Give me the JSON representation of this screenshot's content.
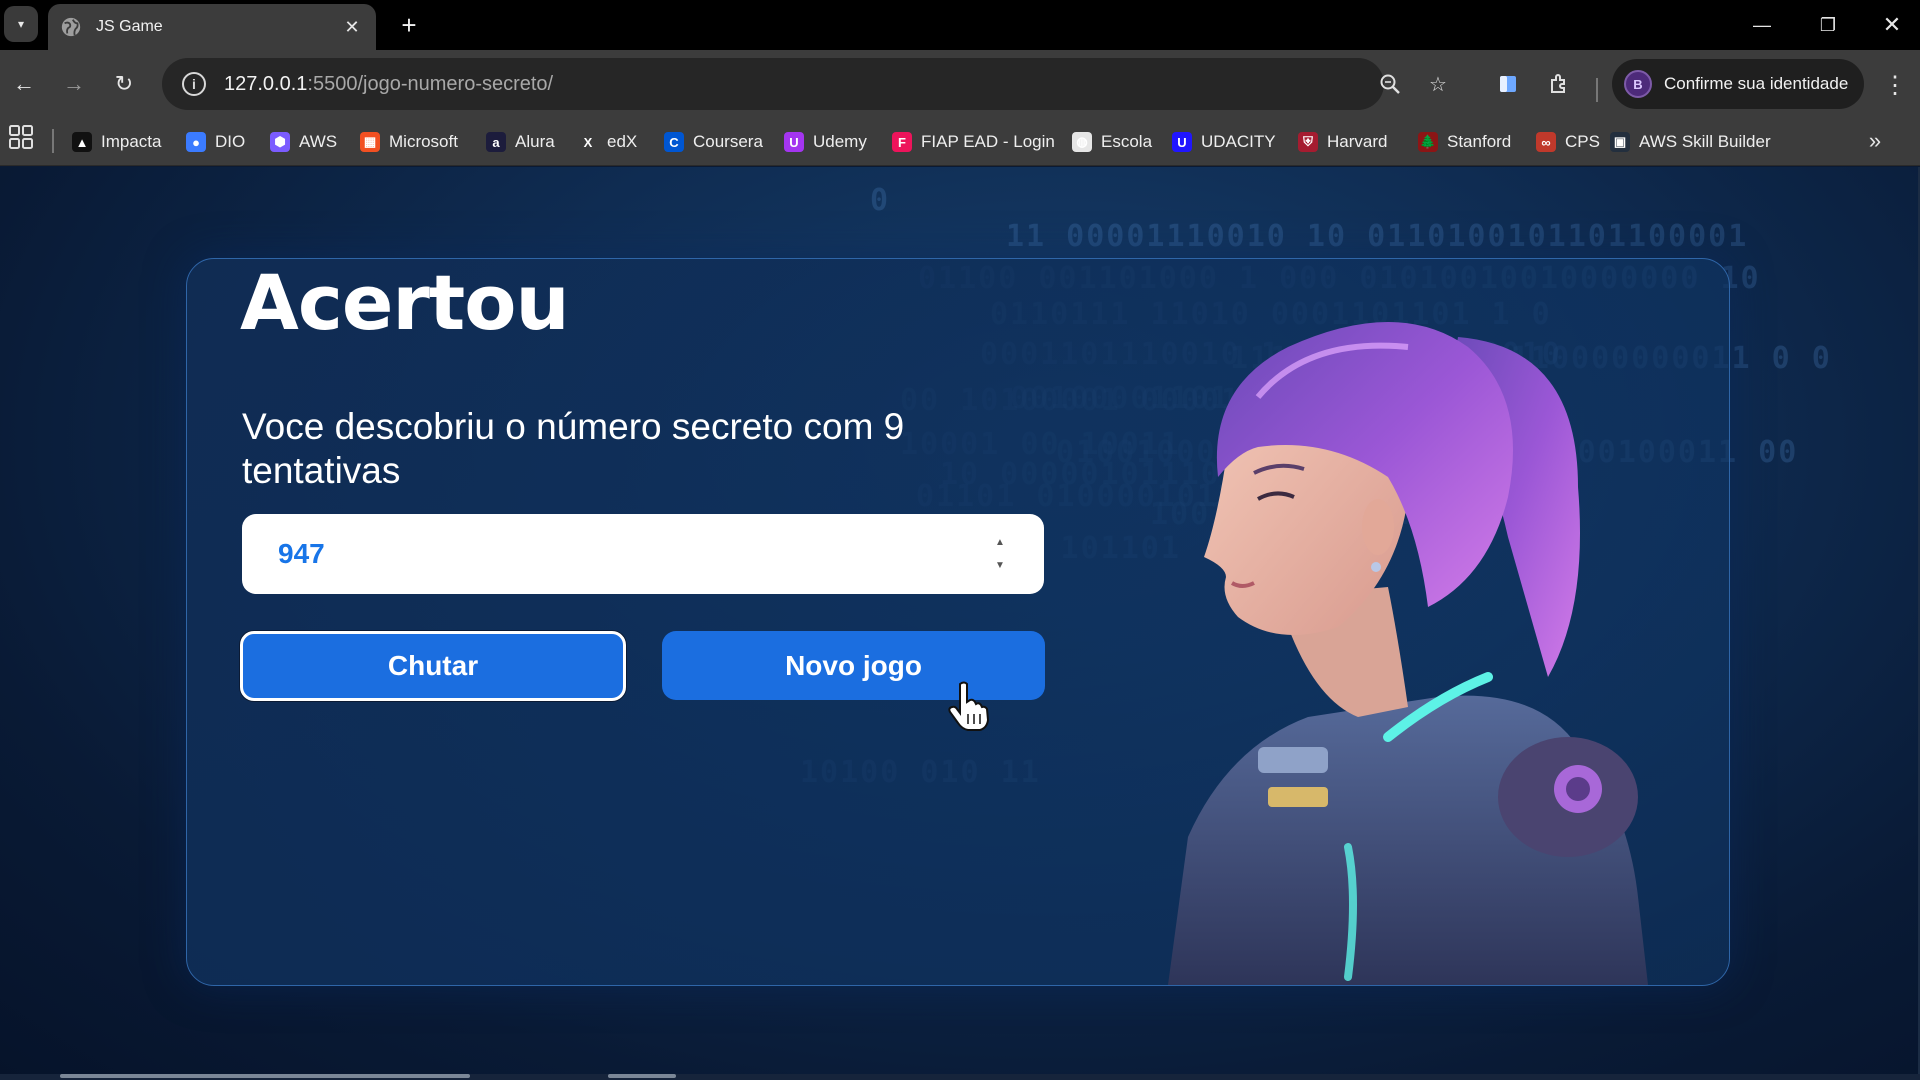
{
  "browser": {
    "tab_title": "JS Game",
    "url_host": "127.0.0.1",
    "url_path": ":5500/jogo-numero-secreto/",
    "profile_initial": "B",
    "profile_label": "Confirme sua identidade"
  },
  "bookmarks": [
    {
      "label": "Impacta",
      "icon": "impacta-icon",
      "color": "#111111"
    },
    {
      "label": "DIO",
      "icon": "dio-icon",
      "color": "#3b7bff"
    },
    {
      "label": "AWS",
      "icon": "aws-cube-icon",
      "color": "#7b5cff"
    },
    {
      "label": "Microsoft",
      "icon": "microsoft-icon",
      "color": "#f25022"
    },
    {
      "label": "Alura",
      "icon": "alura-icon",
      "color": "#1c1c3c"
    },
    {
      "label": "edX",
      "icon": "edx-icon",
      "color": "#3c3c3c"
    },
    {
      "label": "Coursera",
      "icon": "coursera-icon",
      "color": "#0056d2"
    },
    {
      "label": "Udemy",
      "icon": "udemy-icon",
      "color": "#a435f0"
    },
    {
      "label": "FIAP EAD - Login",
      "icon": "fiap-icon",
      "color": "#ed145b"
    },
    {
      "label": "Escola",
      "icon": "globe-icon",
      "color": "#e6e6e6"
    },
    {
      "label": "UDACITY",
      "icon": "udacity-icon",
      "color": "#2015ff"
    },
    {
      "label": "Harvard",
      "icon": "harvard-icon",
      "color": "#a51c30"
    },
    {
      "label": "Stanford",
      "icon": "stanford-icon",
      "color": "#8c1515"
    },
    {
      "label": "CPS",
      "icon": "cps-icon",
      "color": "#c0392b"
    },
    {
      "label": "AWS Skill Builder",
      "icon": "aws-skill-builder-icon",
      "color": "#232f3e"
    }
  ],
  "game": {
    "title": "Acertou",
    "message": "Voce descobriu o número secreto com 9 tentativas",
    "input_value": "947",
    "guess_button": "Chutar",
    "new_game_button": "Novo jogo"
  },
  "background_binary": [
    "0",
    "11 00001110010 10 0110100101101100001",
    "01100 001101000  1 000 01010010010000000 10",
    "0110111 11010   0001101101  1 0",
    "0001101110010   1  1011010000010",
    "111111101000  0110000000011 0 0",
    "00 10100001   000011",
    "00100001101 0",
    "10001 00 10011",
    "01001000001101000000000 1  00100011 00",
    "10 000001011100001",
    "01101 01000010111101",
    "10011 00001110",
    "00 01111  101101",
    "10100 010 11"
  ],
  "colors": {
    "accent_button": "#1b6ee0",
    "input_text": "#1875e8",
    "card_border": "#2f66a8"
  }
}
